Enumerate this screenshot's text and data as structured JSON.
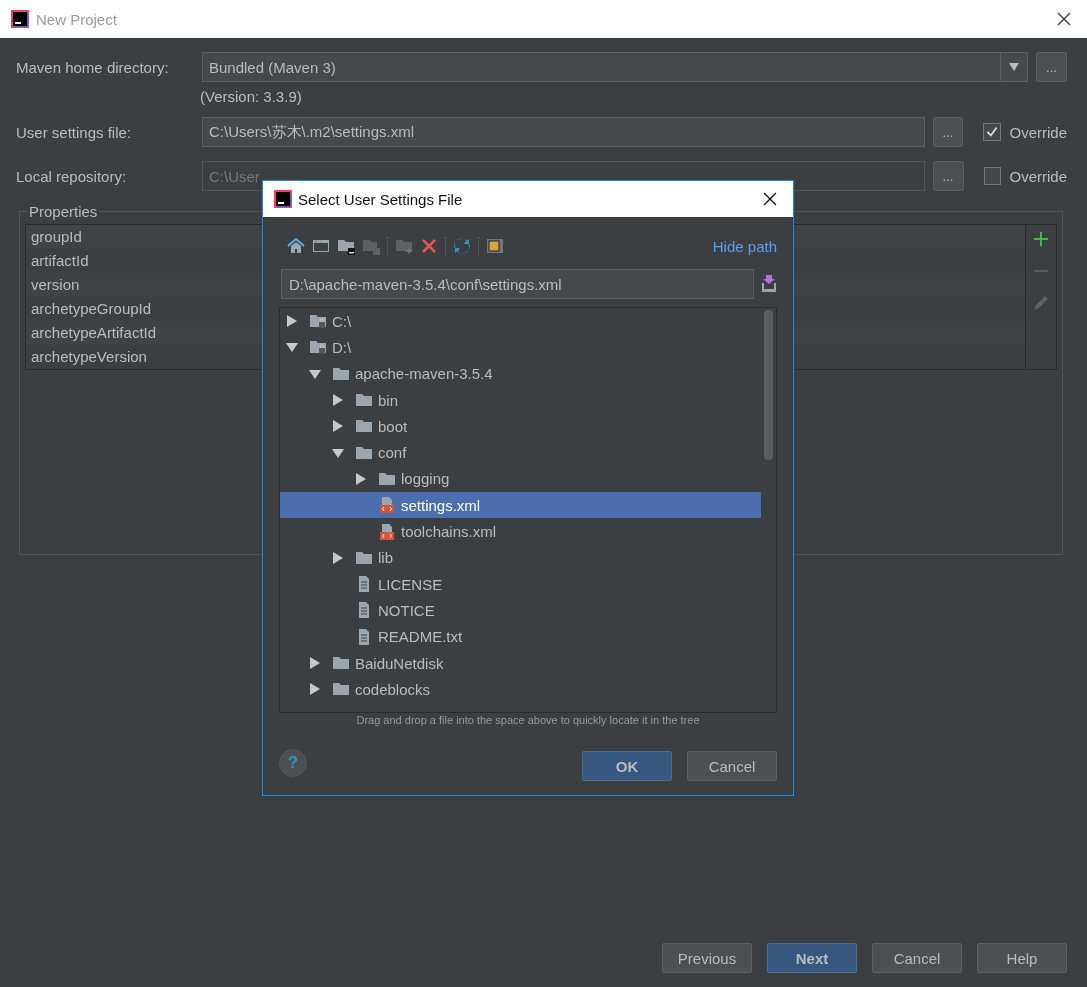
{
  "window": {
    "title": "New Project"
  },
  "form": {
    "maven_home": {
      "label": "Maven home directory:",
      "value": "Bundled (Maven 3)",
      "button": "..."
    },
    "version_note": "(Version: 3.3.9)",
    "user_settings": {
      "label": "User settings file:",
      "value": "C:\\Users\\苏木\\.m2\\settings.xml",
      "disabled": false,
      "button": "...",
      "override": {
        "label": "Override",
        "checked": true
      }
    },
    "local_repository": {
      "label": "Local repository:",
      "value": "C:\\User",
      "disabled": true,
      "button": "...",
      "override": {
        "label": "Override",
        "checked": false
      }
    }
  },
  "properties": {
    "title": "Properties",
    "rows": [
      "groupId",
      "artifactId",
      "version",
      "archetypeGroupId",
      "archetypeArtifactId",
      "archetypeVersion"
    ]
  },
  "buttons": [
    {
      "label": "Previous",
      "primary": false
    },
    {
      "label": "Next",
      "primary": true
    },
    {
      "label": "Cancel",
      "primary": false
    },
    {
      "label": "Help",
      "primary": false
    }
  ],
  "dialog": {
    "title": "Select User Settings File",
    "hide_path": "Hide path",
    "path": "D:\\apache-maven-3.5.4\\conf\\settings.xml",
    "tree": [
      {
        "label": "C:\\",
        "kind": "drive",
        "expanded": false,
        "selected": false
      },
      {
        "label": "D:\\",
        "kind": "drive",
        "expanded": true,
        "selected": false,
        "children": [
          {
            "label": "apache-maven-3.5.4",
            "kind": "folder",
            "expanded": true,
            "selected": false,
            "children": [
              {
                "label": "bin",
                "kind": "folder",
                "expanded": false,
                "selected": false
              },
              {
                "label": "boot",
                "kind": "folder",
                "expanded": false,
                "selected": false
              },
              {
                "label": "conf",
                "kind": "folder",
                "expanded": true,
                "selected": false,
                "children": [
                  {
                    "label": "logging",
                    "kind": "folder",
                    "expanded": false,
                    "selected": false
                  },
                  {
                    "label": "settings.xml",
                    "kind": "xml",
                    "selected": true
                  },
                  {
                    "label": "toolchains.xml",
                    "kind": "xml",
                    "selected": false
                  }
                ]
              },
              {
                "label": "lib",
                "kind": "folder",
                "expanded": false,
                "selected": false
              },
              {
                "label": "LICENSE",
                "kind": "text",
                "selected": false
              },
              {
                "label": "NOTICE",
                "kind": "text",
                "selected": false
              },
              {
                "label": "README.txt",
                "kind": "text",
                "selected": false
              }
            ]
          },
          {
            "label": "BaiduNetdisk",
            "kind": "folder",
            "expanded": false,
            "selected": false
          },
          {
            "label": "codeblocks",
            "kind": "folder",
            "expanded": false,
            "selected": false
          }
        ]
      }
    ],
    "hint": "Drag and drop a file into the space above to quickly locate it in the tree",
    "help": "?",
    "buttons": [
      {
        "label": "OK",
        "primary": true
      },
      {
        "label": "Cancel",
        "primary": false
      }
    ]
  }
}
